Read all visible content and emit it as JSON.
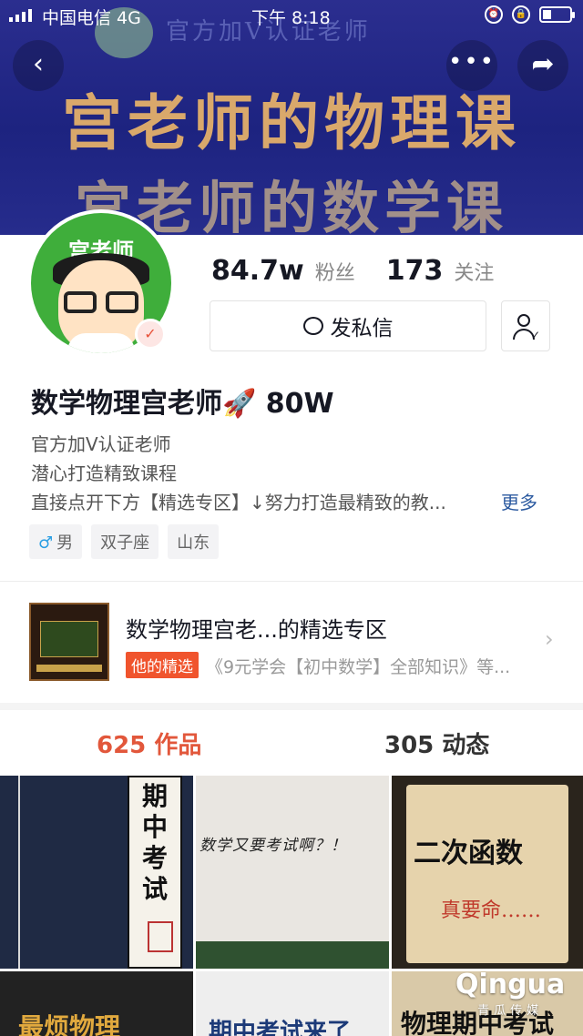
{
  "status_bar": {
    "carrier": "中国电信 4G",
    "time": "下午 8:18"
  },
  "banner": {
    "top_text": "官方加V认证老师",
    "line1": "宫老师的物理课",
    "line2": "宫老师的数学课"
  },
  "nav": {
    "back_icon": "‹",
    "more_icon": "•••",
    "share_icon": "➦"
  },
  "profile": {
    "avatar_label": "宫老师",
    "followers_count": "84.7w",
    "followers_label": "粉丝",
    "following_count": "173",
    "following_label": "关注",
    "message_button": "发私信",
    "name": "数学物理宫老师🚀 80W",
    "bio_lines": [
      "官方加V认证老师",
      "潜心打造精致课程",
      "直接点开下方【精选专区】↓努力打造最精致的教..."
    ],
    "more_link": "更多",
    "tags": [
      {
        "icon": "♂",
        "label": "男"
      },
      {
        "label": "双子座"
      },
      {
        "label": "山东"
      }
    ]
  },
  "featured": {
    "title": "数学物理宫老...的精选专区",
    "badge": "他的精选",
    "description": "《9元学会【初中数学】全部知识》等..."
  },
  "tabs": {
    "works": "625 作品",
    "dynamic": "305 动态"
  },
  "videos": [
    {
      "text": "期中考试"
    },
    {
      "text": "数学又要考试啊？！"
    },
    {
      "title": "二次函数",
      "subtitle": "真要命……"
    },
    {
      "text": "最烦物理"
    },
    {
      "text": "期中考试来了"
    },
    {
      "text": "物理期中考试"
    }
  ],
  "watermark": {
    "logo": "Qingua",
    "sub": "青瓜传媒"
  },
  "colors": {
    "accent": "#e2573b",
    "link": "#2c5aa0",
    "banner_bg": "#1d2380",
    "banner_text": "#d9a86b"
  }
}
